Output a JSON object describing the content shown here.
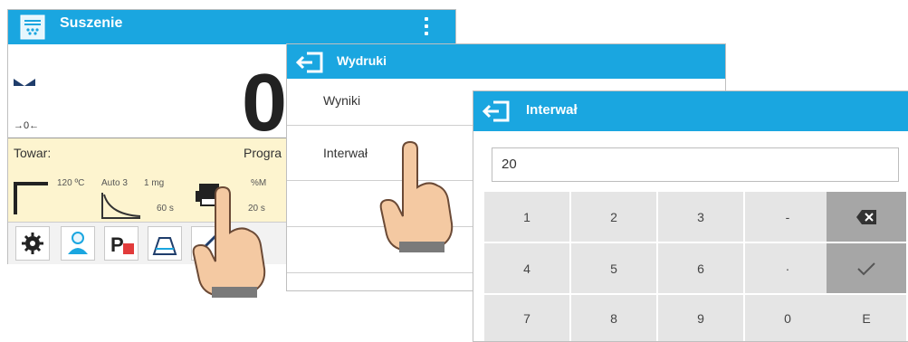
{
  "panel1": {
    "title": "Suszenie",
    "weight": "0",
    "zero_indicator": "→0←",
    "towar_label": "Towar:",
    "program_label": "Progra",
    "info": {
      "temp": "120 ºC",
      "auto": "Auto 3",
      "mg": "1 mg",
      "sec60": "60 s",
      "percent": "%M",
      "sec20": "20 s"
    },
    "icons": [
      "gear-icon",
      "user-icon",
      "product-database-icon",
      "weighing-icon",
      "settings-icon"
    ]
  },
  "panel2": {
    "title": "Wydruki",
    "items": [
      "Wyniki",
      "Interwał"
    ]
  },
  "panel3": {
    "title": "Interwał",
    "input_value": "20",
    "keys": [
      [
        "1",
        "2",
        "3",
        "-",
        "⌫"
      ],
      [
        "4",
        "5",
        "6",
        "·",
        "✓"
      ],
      [
        "7",
        "8",
        "9",
        "0",
        "E"
      ]
    ]
  },
  "colors": {
    "accent": "#1aa6e0",
    "yellow_bg": "#fdf4cf",
    "key_bg": "#e5e5e5",
    "key_dark": "#a6a6a6"
  }
}
